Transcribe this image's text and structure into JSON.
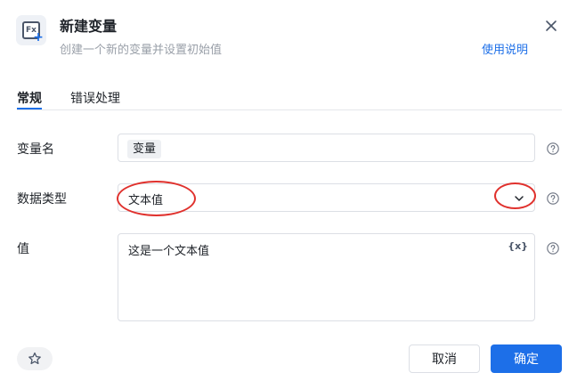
{
  "header": {
    "icon": "function-variable-add-icon",
    "title": "新建变量",
    "subtitle": "创建一个新的变量并设置初始值",
    "help_link": "使用说明"
  },
  "tabs": [
    {
      "label": "常规",
      "active": true
    },
    {
      "label": "错误处理",
      "active": false
    }
  ],
  "form": {
    "variable_name": {
      "label": "变量名",
      "value": "变量"
    },
    "data_type": {
      "label": "数据类型",
      "value": "文本值"
    },
    "value": {
      "label": "值",
      "value": "这是一个文本值",
      "insert_variable_label": "{x}"
    }
  },
  "footer": {
    "cancel_label": "取消",
    "confirm_label": "确定"
  },
  "colors": {
    "accent": "#1d6fe8",
    "annotation": "#e0312d"
  }
}
